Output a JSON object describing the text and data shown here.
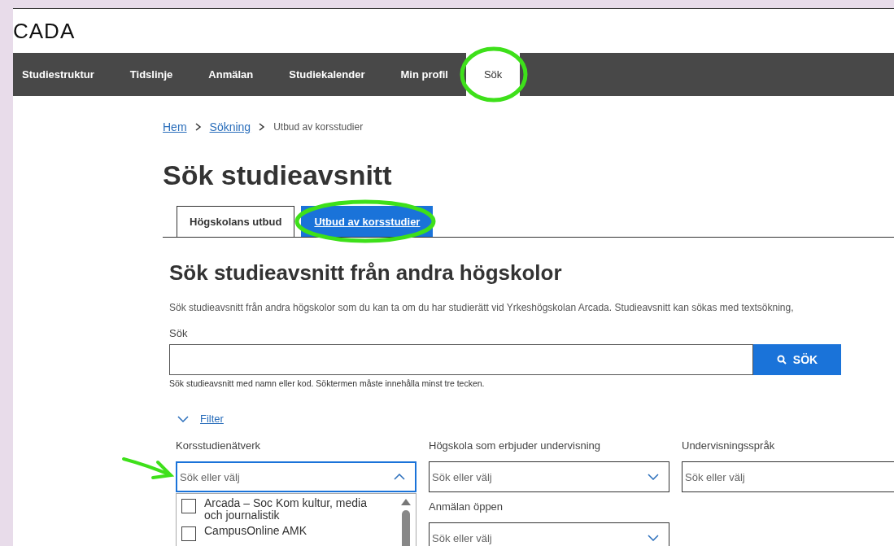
{
  "logo": "CADA",
  "nav": [
    {
      "label": "Studiestruktur",
      "selected": false
    },
    {
      "label": "Tidslinje",
      "selected": false
    },
    {
      "label": "Anmälan",
      "selected": false
    },
    {
      "label": "Studiekalender",
      "selected": false
    },
    {
      "label": "Min profil",
      "selected": false
    },
    {
      "label": "Sök",
      "selected": true
    }
  ],
  "breadcrumb": [
    {
      "label": "Hem",
      "kind": "link"
    },
    {
      "label": "Sökning",
      "kind": "link"
    },
    {
      "label": "Utbud av korsstudier",
      "kind": "current"
    }
  ],
  "title": "Sök studieavsnitt",
  "tabs": [
    {
      "label": "Högskolans utbud",
      "selected": false
    },
    {
      "label": "Utbud av korsstudier",
      "selected": true
    }
  ],
  "section": {
    "heading": "Sök studieavsnitt från andra högskolor",
    "intro": "Sök studieavsnitt från andra högskolor som du kan ta om du har studierätt vid Yrkeshögskolan Arcada. Studieavsnitt kan sökas med textsökning,",
    "search": {
      "label": "Sök",
      "button": "SÖK",
      "hint": "Sök studieavsnitt med namn eller kod. Söktermen måste innehålla minst tre tecken."
    },
    "filter": {
      "label": "Filter",
      "expanded": true,
      "fields": [
        {
          "label": "Korsstudienätverk",
          "placeholder": "Sök eller välj",
          "expanded": true,
          "options": [
            {
              "label": "Arcada – Soc Kom kultur, media och journalistik",
              "checked": false
            },
            {
              "label": "CampusOnline AMK",
              "checked": false
            }
          ]
        },
        {
          "label": "Högskola som erbjuder undervisning",
          "placeholder": "Sök eller välj",
          "expanded": false
        },
        {
          "label": "Undervisningsspråk",
          "placeholder": "Sök eller välj",
          "expanded": false
        },
        {
          "label": "Anmälan öppen",
          "placeholder": "Sök eller välj",
          "expanded": false
        }
      ]
    }
  },
  "annotations": [
    {
      "kind": "ellipse"
    },
    {
      "kind": "ellipse"
    },
    {
      "kind": "arrow"
    }
  ]
}
